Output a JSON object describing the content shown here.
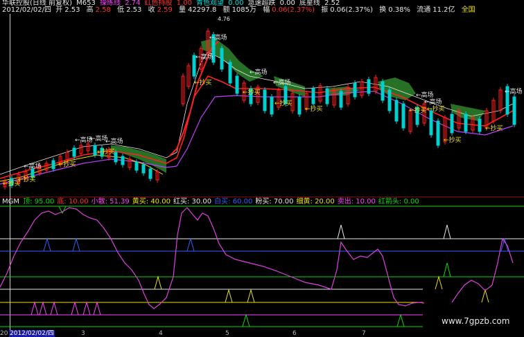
{
  "header": {
    "title": "华联控股(日线 前复权)",
    "indicator_name": "M653",
    "items": [
      {
        "label": "操练线",
        "value": "2.74",
        "color": "#ff40ff"
      },
      {
        "label": "红色持股",
        "value": "1.00",
        "color": "#ff3030"
      },
      {
        "label": "青色观望",
        "value": "0.00",
        "color": "#00e0e0"
      },
      {
        "label": "急速超跌",
        "value": "0.00",
        "color": "#e8e8e8"
      },
      {
        "label": "底星线",
        "value": "2.52",
        "color": "#e8e8e8"
      }
    ]
  },
  "ohlc": {
    "date": "2012/02/02/四",
    "open_label": "开",
    "open": "2.53",
    "high_label": "高",
    "high": "2.58",
    "low_label": "低",
    "low": "2.53",
    "close_label": "收",
    "close": "2.59",
    "volume_label": "量",
    "volume": "42297.8",
    "amount_label": "额",
    "amount": "1085万",
    "change_label": "幅",
    "change": "0.06(2.37%)",
    "swing_label": "振",
    "swing": "0.06(2.37%)",
    "turnover_label": "换",
    "turnover": "0.38%",
    "float_label": "流通",
    "float": "11.2亿",
    "region": "全国"
  },
  "price_chart": {
    "peak_label": "4.76",
    "annotations": [
      {
        "text": "←高场",
        "color": "#e8e8e8"
      },
      {
        "text": "←抄买",
        "color": "#f0e000"
      }
    ]
  },
  "indicator_panel": {
    "name": "MGM",
    "params": [
      {
        "label": "顶",
        "value": "95.00",
        "color": "#00e000"
      },
      {
        "label": "底",
        "value": "10.00",
        "color": "#ff3030"
      },
      {
        "label": "小散",
        "value": "51.39",
        "color": "#ff40ff"
      },
      {
        "label": "黄买",
        "value": "40.00",
        "color": "#f0e000"
      },
      {
        "label": "红买",
        "value": "30.00",
        "color": "#e8e8e8"
      },
      {
        "label": "白买",
        "value": "60.00",
        "color": "#3060ff"
      },
      {
        "label": "粉买",
        "value": "70.00",
        "color": "#e8e8e8"
      },
      {
        "label": "细黄",
        "value": "20.00",
        "color": "#f0e000"
      },
      {
        "label": "卖出",
        "value": "10.00",
        "color": "#ff40ff"
      },
      {
        "label": "红箭头",
        "value": "0.00",
        "color": "#00e000"
      }
    ]
  },
  "x_axis": {
    "cursor_date": "2012/02/02/四",
    "left_fragment": "20",
    "ticks": [
      "3",
      "4",
      "5",
      "6",
      "7"
    ]
  },
  "watermark": "www.7gpzb.com"
}
